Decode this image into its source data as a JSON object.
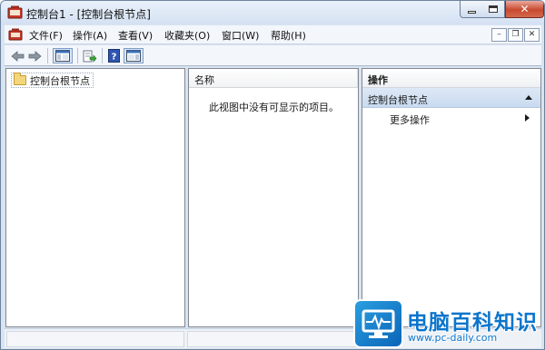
{
  "window": {
    "title": "控制台1 - [控制台根节点]"
  },
  "menu": {
    "items": [
      "文件(F)",
      "操作(A)",
      "查看(V)",
      "收藏夹(O)",
      "窗口(W)",
      "帮助(H)"
    ]
  },
  "icons": {
    "app": "console-app-icon",
    "back": "back-arrow-icon",
    "forward": "forward-arrow-icon",
    "show_hide_tree": "console-tree-icon",
    "export": "export-list-icon",
    "help": "help-icon",
    "show_hide_action": "action-pane-icon"
  },
  "tree": {
    "root_label": "控制台根节点"
  },
  "list": {
    "column_name": "名称",
    "empty_message": "此视图中没有可显示的项目。"
  },
  "actions": {
    "header": "操作",
    "group_label": "控制台根节点",
    "more_actions": "更多操作"
  },
  "watermark": {
    "title": "电脑百科知识",
    "url": "www.pc-daily.com"
  },
  "colors": {
    "accent": "#0b75cc",
    "close_button": "#c8492f",
    "action_group_bg": "#c9dbf0"
  }
}
